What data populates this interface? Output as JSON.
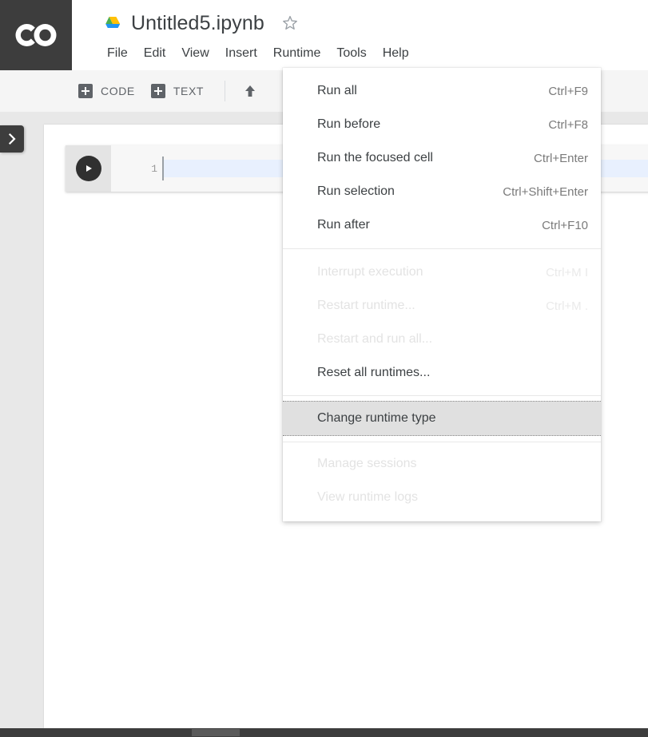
{
  "app": {
    "logo_text": "CO",
    "logo_icon": "colab-logo-icon"
  },
  "header": {
    "drive_icon": "google-drive-icon",
    "doc_title": "Untitled5.ipynb",
    "star_icon": "star-outline-icon",
    "menubar": [
      {
        "label": "File",
        "open": false
      },
      {
        "label": "Edit",
        "open": false
      },
      {
        "label": "View",
        "open": false
      },
      {
        "label": "Insert",
        "open": false
      },
      {
        "label": "Runtime",
        "open": true
      },
      {
        "label": "Tools",
        "open": false
      },
      {
        "label": "Help",
        "open": false
      }
    ]
  },
  "toolbar": {
    "add_code_label": "CODE",
    "add_text_label": "TEXT",
    "add_icon": "plus-box-icon",
    "upload_icon": "arrow-up-icon"
  },
  "sidebar": {
    "toggle_icon": "chevron-right-icon"
  },
  "cell": {
    "run_icon": "play-icon",
    "line_number": "1",
    "code_text": ""
  },
  "runtime_menu": {
    "groups": [
      {
        "items": [
          {
            "label": "Run all",
            "accel": "Ctrl+F9",
            "disabled": false,
            "highlight": false
          },
          {
            "label": "Run before",
            "accel": "Ctrl+F8",
            "disabled": false,
            "highlight": false
          },
          {
            "label": "Run the focused cell",
            "accel": "Ctrl+Enter",
            "disabled": false,
            "highlight": false
          },
          {
            "label": "Run selection",
            "accel": "Ctrl+Shift+Enter",
            "disabled": false,
            "highlight": false
          },
          {
            "label": "Run after",
            "accel": "Ctrl+F10",
            "disabled": false,
            "highlight": false
          }
        ]
      },
      {
        "items": [
          {
            "label": "Interrupt execution",
            "accel": "Ctrl+M I",
            "disabled": true,
            "highlight": false
          },
          {
            "label": "Restart runtime...",
            "accel": "Ctrl+M .",
            "disabled": true,
            "highlight": false
          },
          {
            "label": "Restart and run all...",
            "accel": "",
            "disabled": true,
            "highlight": false
          },
          {
            "label": "Reset all runtimes...",
            "accel": "",
            "disabled": false,
            "highlight": false
          }
        ]
      },
      {
        "items": [
          {
            "label": "Change runtime type",
            "accel": "",
            "disabled": false,
            "highlight": true
          }
        ]
      },
      {
        "items": [
          {
            "label": "Manage sessions",
            "accel": "",
            "disabled": true,
            "highlight": false
          },
          {
            "label": "View runtime logs",
            "accel": "",
            "disabled": true,
            "highlight": false
          }
        ]
      }
    ]
  },
  "colors": {
    "logo_bg": "#3d3d3d",
    "toolbar_bg": "#f5f5f5",
    "canvas_bg": "#e8e8e8",
    "menu_highlight": "#e0e0e0",
    "code_active_line": "#e8f0fe",
    "text_primary": "#3c4043",
    "text_muted": "#7a7a7a",
    "text_disabled": "#e3e3e3"
  }
}
